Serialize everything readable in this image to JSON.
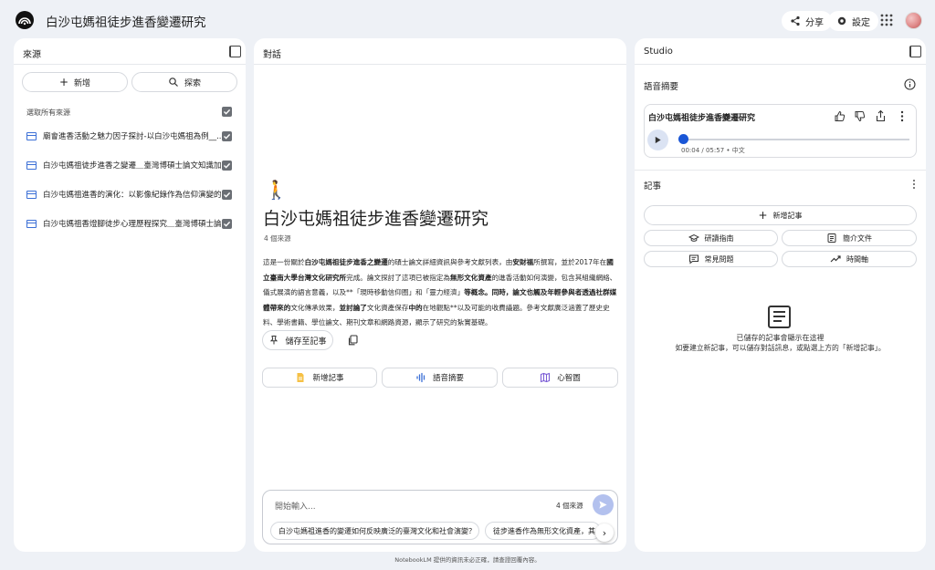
{
  "app": {
    "title": "白沙屯媽祖徒步進香變遷研究"
  },
  "header": {
    "share_label": "分享",
    "settings_label": "設定"
  },
  "sources": {
    "title": "來源",
    "add_label": "新增",
    "discover_label": "探索",
    "select_all_label": "選取所有來源",
    "items": [
      {
        "title": "廟會進香活動之魅力因子探討-以白沙屯媽祖為例__..."
      },
      {
        "title": "白沙屯媽祖徒步進香之變遷＿臺灣博碩士論文知識加..."
      },
      {
        "title": "白沙屯媽祖進香的演化：以影像紀錄作為信仰演變的..."
      },
      {
        "title": "白沙屯媽祖香燈腳徒步心理歷程探究＿臺灣博碩士論..."
      }
    ]
  },
  "chat": {
    "title": "對話",
    "emoji": "🚶",
    "notebook_title": "白沙屯媽祖徒步進香變遷研究",
    "source_count": "4 個來源",
    "summary": [
      {
        "t": "這是一份關於",
        "b": false
      },
      {
        "t": "白沙屯媽祖徒步進香之變遷",
        "b": true
      },
      {
        "t": "的碩士論文詳細資訊與參考文獻列表，由",
        "b": false
      },
      {
        "t": "安財福",
        "b": true
      },
      {
        "t": "所撰寫，並於2017年在",
        "b": false
      },
      {
        "t": "國立臺南大學台灣文化研究所",
        "b": true
      },
      {
        "t": "完成。論文探討了這項已被指定為",
        "b": false
      },
      {
        "t": "無形文化資產",
        "b": true
      },
      {
        "t": "的進香活動如何演變，包含其組織網絡、儀式展演的語言意義，以及**「現時移動信仰圈」和「靈力經濟」",
        "b": false
      },
      {
        "t": "等概念。同時，論文也觸及年輕參與者透過社群媒體帶來的",
        "b": true
      },
      {
        "t": "文化傳承效果，",
        "b": false
      },
      {
        "t": "並討論了",
        "b": true
      },
      {
        "t": "文化資產保存",
        "b": false
      },
      {
        "t": "中的",
        "b": true
      },
      {
        "t": "在地觀點**以及可能的收費議題。參考文獻廣泛涵蓋了歷史史料、學術書籍、學位論文、期刊文章和網路資源，顯示了研究的紮實基礎。",
        "b": false
      }
    ],
    "save_note_label": "儲存至記事",
    "actions": {
      "add_note": "新增記事",
      "audio_overview": "語音摘要",
      "mind_map": "心智圖"
    },
    "input": {
      "placeholder": "開始輸入...",
      "source_count": "4 個來源"
    },
    "suggestions": [
      "白沙屯媽祖進香的變遷如何反映廣泛的臺灣文化和社會演變？",
      "徒步進香作為無形文化資產，其"
    ],
    "disclaimer": "NotebookLM 提供的資訊未必正確，請查證回覆內容。"
  },
  "studio": {
    "title": "Studio",
    "audio_section_label": "語音摘要",
    "audio_title": "白沙屯媽祖徒步進香變遷研究",
    "audio_time": "00:04 / 05:57 • 中文",
    "audio_progress": 0.011,
    "notes_label": "記事",
    "add_note_label": "新增記事",
    "study_guide": "研讀指南",
    "briefing_doc": "簡介文件",
    "faq": "常見問題",
    "timeline": "時間軸",
    "empty_line1": "已儲存的記事會顯示在這裡",
    "empty_line2": "如要建立新記事，可以儲存對話訊息，或點選上方的「新增記事」。"
  },
  "colors": {
    "accent": "#1a56d6",
    "page_bg": "#eef1f6",
    "panel_bg": "#ffffff"
  }
}
